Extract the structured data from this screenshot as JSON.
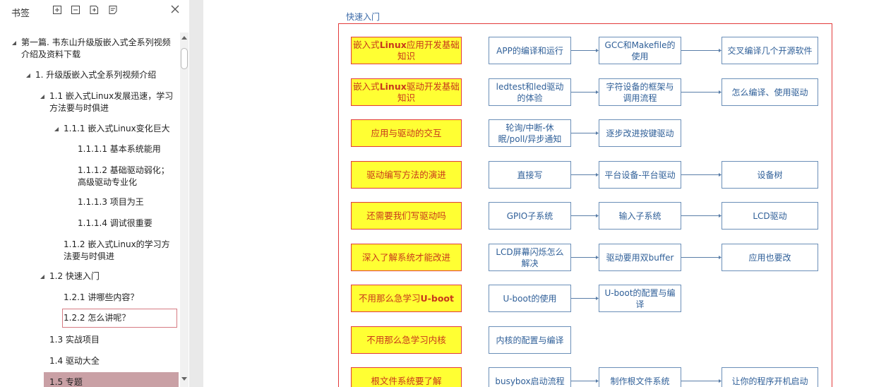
{
  "sidebar": {
    "title": "书签",
    "tree": [
      {
        "label": "第一篇. 韦东山升级版嵌入式全系列视频介绍及资料下载"
      },
      {
        "label": "1. 升级版嵌入式全系列视频介绍"
      },
      {
        "label": "1.1 嵌入式Linux发展迅速，学习方法要与时俱进"
      },
      {
        "label": "1.1.1 嵌入式Linux变化巨大"
      },
      {
        "label": "1.1.1.1 基本系统能用"
      },
      {
        "label": "1.1.1.2 基础驱动弱化；高级驱动专业化"
      },
      {
        "label": "1.1.1.3 项目为王"
      },
      {
        "label": "1.1.1.4 调试很重要"
      },
      {
        "label": "1.1.2 嵌入式Linux的学习方法要与时俱进"
      },
      {
        "label": "1.2 快速入门"
      },
      {
        "label": "1.2.1 讲哪些内容？"
      },
      {
        "label": "1.2.2 怎么讲呢？"
      },
      {
        "label": "1.3 实战项目"
      },
      {
        "label": "1.4 驱动大全"
      },
      {
        "label": "1.5 专题"
      }
    ]
  },
  "doc": {
    "section_title": "快速入门",
    "rows": [
      {
        "topic": "嵌入式|Linux|应用开发基础知识",
        "steps": [
          "APP的编译和运行",
          "GCC和Makefile的使用",
          "交叉编译几个开源软件"
        ]
      },
      {
        "topic": "嵌入式|Linux|驱动开发基础知识",
        "steps": [
          "ledtest和led驱动的体验",
          "字符设备的框架与调用流程",
          "怎么编译、使用驱动"
        ]
      },
      {
        "topic": "应用与驱动的交互",
        "steps": [
          "轮询/中断-休眠/poll/异步通知",
          "逐步改进按键驱动"
        ]
      },
      {
        "topic": "驱动编写方法的演进",
        "steps": [
          "直接写",
          "平台设备-平台驱动",
          "设备树"
        ]
      },
      {
        "topic": "还需要我们写驱动吗",
        "steps": [
          "GPIO子系统",
          "输入子系统",
          "LCD驱动"
        ]
      },
      {
        "topic": "深入了解系统才能改进",
        "steps": [
          "LCD屏幕闪烁怎么解决",
          "驱动要用双buffer",
          "应用也要改"
        ]
      },
      {
        "topic": "不用那么急学习|U-boot|",
        "steps": [
          "U-boot的使用",
          "U-boot的配置与编译"
        ]
      },
      {
        "topic": "不用那么急学习内核",
        "steps": [
          "内核的配置与编译"
        ]
      },
      {
        "topic": "根文件系统要了解",
        "steps": [
          "busybox启动流程",
          "制作根文件系统",
          "让你的程序开机启动"
        ]
      }
    ]
  },
  "colors": {
    "accent_red": "#e23b3b",
    "topic_fill": "#ffff33",
    "step_border": "#6b8fb8",
    "step_text": "#2f5f98",
    "selected_bg": "#c9a0a5"
  }
}
